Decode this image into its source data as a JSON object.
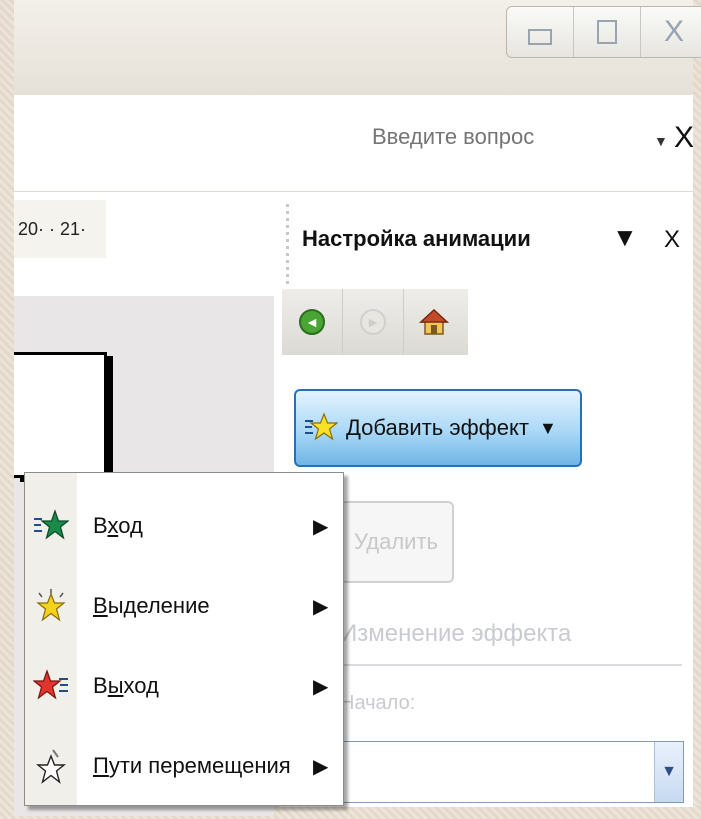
{
  "window": {
    "buttons": [
      {
        "name": "minimize-button"
      },
      {
        "name": "maximize-button"
      },
      {
        "name": "close-button",
        "glyph": "X"
      }
    ]
  },
  "askbar": {
    "placeholder": "Введите вопрос",
    "arrow": "▼",
    "close": "X"
  },
  "ruler": {
    "text": "20· · 21·"
  },
  "task_pane": {
    "title": "Настройка анимации",
    "menu_arrow": "▼",
    "close": "X",
    "nav": {
      "back": "◄",
      "forward": "►",
      "home_icon": "house-icon"
    },
    "add_effect": {
      "label": "Добавить эффект",
      "arrow": "▼"
    },
    "delete": {
      "label": "Удалить"
    },
    "section_title": "Изменение эффекта",
    "start_label": "Начало:",
    "start_value": ""
  },
  "context_menu": {
    "items": [
      {
        "label_prefix": "В",
        "label_accel": "х",
        "label_rest": "од",
        "icon": "entrance-star-icon",
        "color": "#1a8a4a",
        "arrow": "▶"
      },
      {
        "label_prefix": "",
        "label_accel": "В",
        "label_rest": "ыделение",
        "icon": "emphasis-star-icon",
        "color": "#f2d21c",
        "arrow": "▶"
      },
      {
        "label_prefix": "В",
        "label_accel": "ы",
        "label_rest": "ход",
        "icon": "exit-star-icon",
        "color": "#e0342e",
        "arrow": "▶"
      },
      {
        "label_prefix": "",
        "label_accel": "П",
        "label_rest": "ути перемещения",
        "icon": "motion-path-star-icon",
        "color": "#ffffff",
        "arrow": "▶"
      }
    ]
  },
  "colors": {
    "accent_blue": "#2a6fb4",
    "button_gradient_light": "#e3f3ff",
    "button_gradient_dark": "#6fb5e6",
    "disabled_text": "#c9cbd0"
  }
}
